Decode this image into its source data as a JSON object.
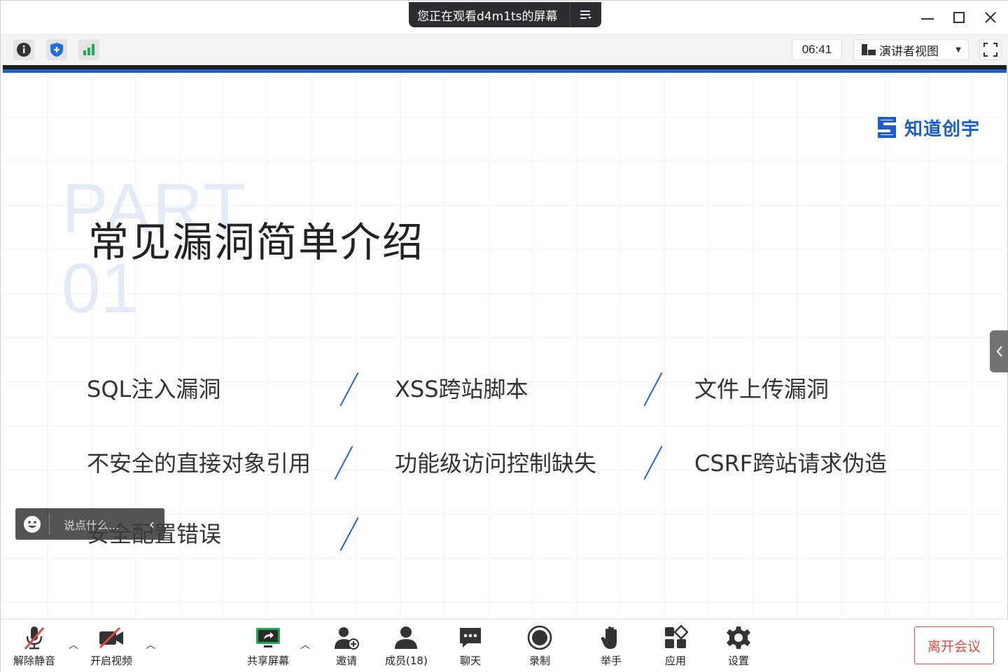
{
  "titlebar": {
    "share_notice": "您正在观看d4m1ts的屏幕",
    "menu_icon": "list-icon",
    "minimize_icon": "minimize-icon",
    "maximize_icon": "maximize-icon",
    "close_icon": "close-icon"
  },
  "toolbar": {
    "icons": [
      "info-icon",
      "shield-icon",
      "signal-icon"
    ],
    "timer": "06:41",
    "view_mode": "演讲者视图",
    "fullscreen_icon": "fullscreen-icon"
  },
  "slide": {
    "logo_text": "知道创宇",
    "part_word": "PART",
    "part_number": "01",
    "title": "常见漏洞简单介绍",
    "items": [
      "SQL注入漏洞",
      "XSS跨站脚本",
      "文件上传漏洞",
      "不安全的直接对象引用",
      "功能级访问控制缺失",
      "CSRF跨站请求伪造",
      "安全配置错误"
    ]
  },
  "chat": {
    "placeholder": "说点什么..."
  },
  "bottombar": {
    "unmute": "解除静音",
    "start_video": "开启视频",
    "share_screen": "共享屏幕",
    "invite": "邀请",
    "members": "成员(18)",
    "chat": "聊天",
    "record": "录制",
    "raise_hand": "举手",
    "apps": "应用",
    "settings": "设置",
    "leave": "离开会议"
  },
  "colors": {
    "accent_blue": "#1b5ccf",
    "leave_red": "#e24a44",
    "share_green": "#1aad55"
  }
}
